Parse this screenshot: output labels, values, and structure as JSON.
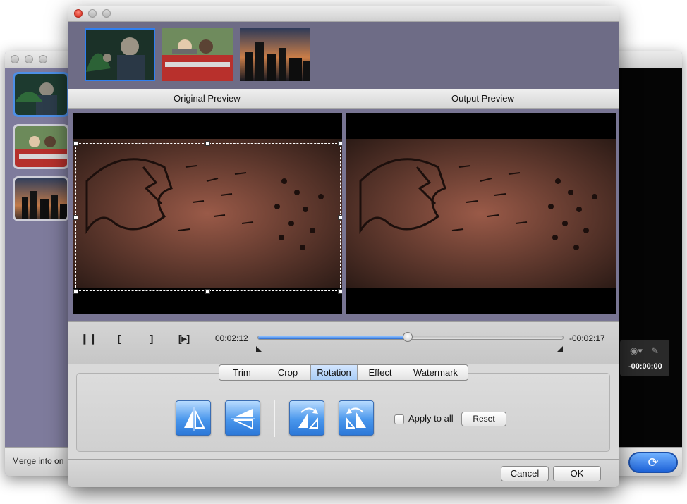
{
  "back_window": {
    "merge_label": "Merge into on",
    "preview_time": "-00:00:00",
    "icons": [
      "camera-icon",
      "edit-icon",
      "convert-icon"
    ]
  },
  "dialog": {
    "headers": {
      "original": "Original Preview",
      "output": "Output Preview"
    },
    "playback": {
      "icons": [
        "pause-icon",
        "mark-in-icon",
        "mark-out-icon",
        "next-frame-icon"
      ],
      "current_time": "00:02:12",
      "remaining_time": "-00:02:17",
      "progress": 0.49
    },
    "tabs": [
      {
        "label": "Trim"
      },
      {
        "label": "Crop"
      },
      {
        "label": "Rotation",
        "active": true
      },
      {
        "label": "Effect"
      },
      {
        "label": "Watermark"
      }
    ],
    "rotation": {
      "buttons": [
        "flip-horizontal-icon",
        "flip-vertical-icon",
        "rotate-clockwise-icon",
        "rotate-counterclockwise-icon"
      ],
      "apply_to_all": "Apply to all",
      "apply_checked": false,
      "reset": "Reset"
    },
    "footer": {
      "cancel": "Cancel",
      "ok": "OK"
    }
  },
  "colors": {
    "accent": "#2f7ff0",
    "strip_background": "#6e6c86",
    "preview_background": "#787593"
  }
}
